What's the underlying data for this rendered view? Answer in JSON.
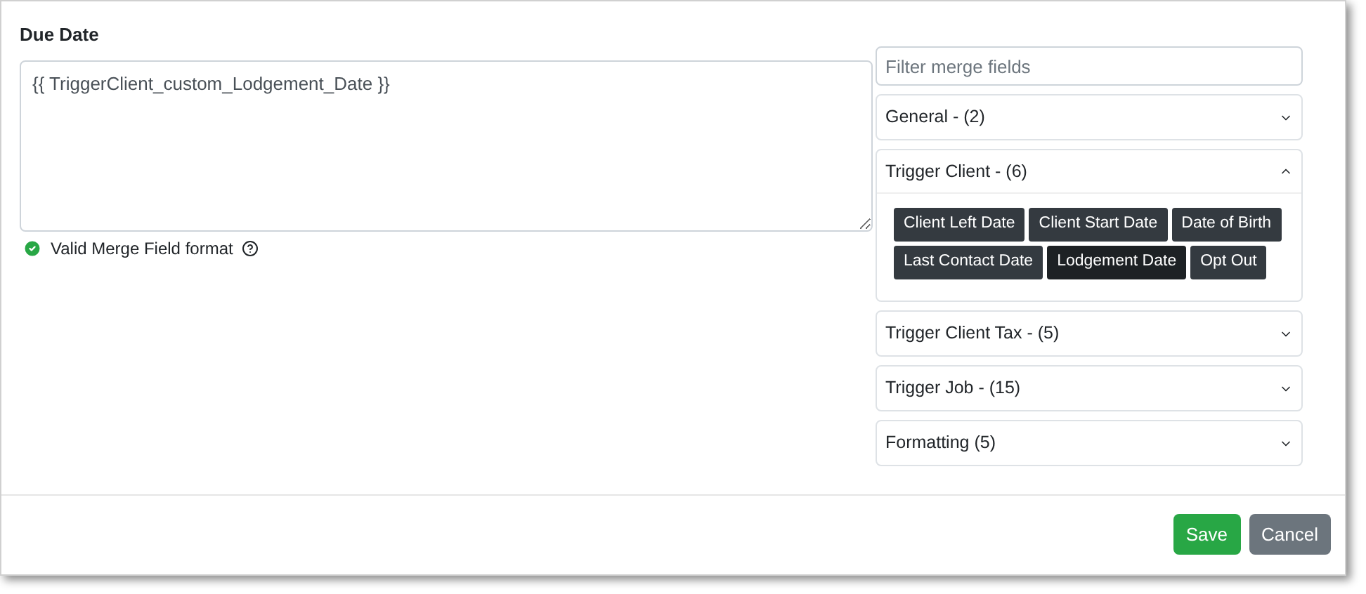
{
  "field": {
    "label": "Due Date",
    "value": "{{ TriggerClient_custom_Lodgement_Date }}",
    "validation": {
      "valid": true,
      "text": "Valid Merge Field format"
    }
  },
  "filter": {
    "placeholder": "Filter merge fields"
  },
  "groups": [
    {
      "title": "General - (2)",
      "expanded": false
    },
    {
      "title": "Trigger Client - (6)",
      "expanded": true,
      "fields": [
        {
          "label": "Client Left Date",
          "selected": false
        },
        {
          "label": "Client Start Date",
          "selected": false
        },
        {
          "label": "Date of Birth",
          "selected": false
        },
        {
          "label": "Last Contact Date",
          "selected": false
        },
        {
          "label": "Lodgement Date",
          "selected": true
        },
        {
          "label": "Opt Out",
          "selected": false
        }
      ]
    },
    {
      "title": "Trigger Client Tax - (5)",
      "expanded": false
    },
    {
      "title": "Trigger Job - (15)",
      "expanded": false
    },
    {
      "title": "Formatting (5)",
      "expanded": false
    }
  ],
  "buttons": [
    {
      "label": "Save",
      "kind": "primary"
    },
    {
      "label": "Cancel",
      "kind": "secondary"
    }
  ]
}
